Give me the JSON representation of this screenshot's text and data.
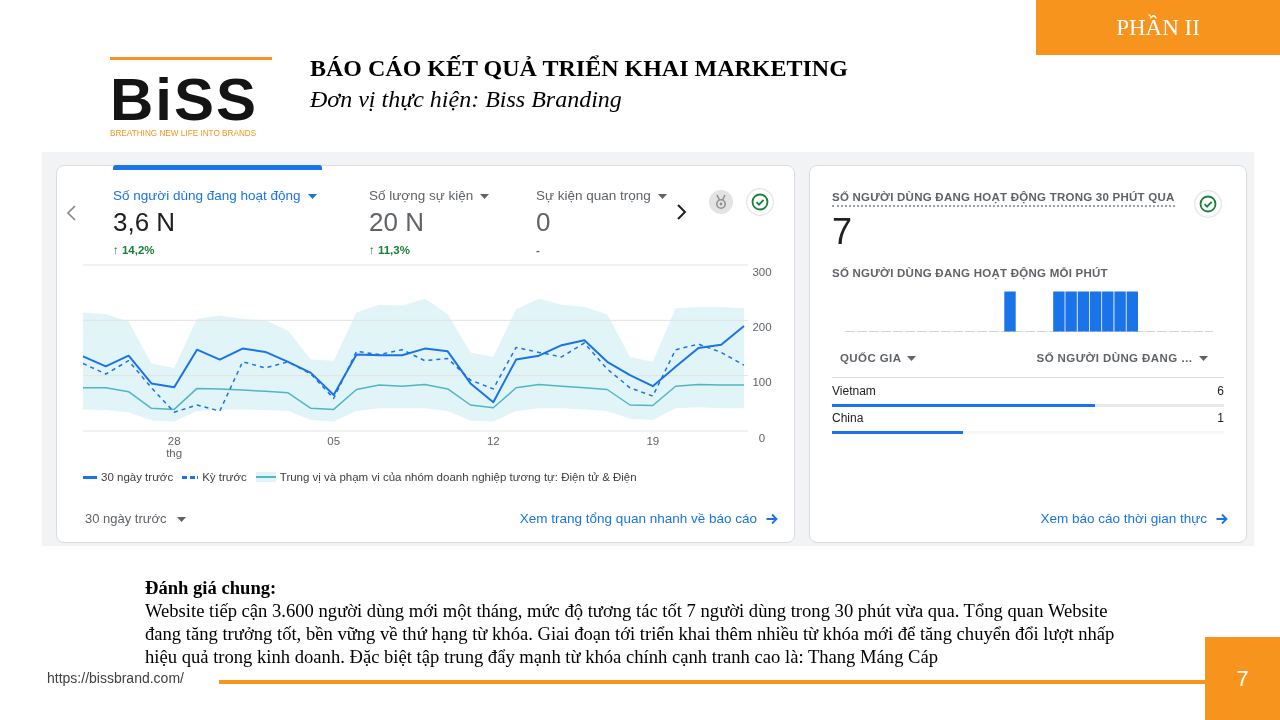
{
  "section_label": "PHẦN II",
  "logo": {
    "wordmark": "BiSS",
    "tagline": "BREATHING NEW LIFE INTO BRANDS"
  },
  "header": {
    "title": "BÁO CÁO KẾT QUẢ TRIỂN KHAI MARKETING",
    "subtitle": "Đơn vị thực hiện: Biss Branding"
  },
  "overview_card": {
    "metrics": [
      {
        "label": "Số người dùng đang hoạt động",
        "value": "3,6 N",
        "change": "↑ 14,2%",
        "positive": true,
        "selected": true
      },
      {
        "label": "Số lượng sự kiện",
        "value": "20 N",
        "change": "↑ 11,3%",
        "positive": true,
        "selected": false
      },
      {
        "label": "Sự kiện quan trọng",
        "value": "0",
        "change": "-",
        "positive": false,
        "selected": false
      }
    ],
    "chart_data": {
      "type": "line",
      "categories": [
        null,
        null,
        null,
        null,
        "28 thg",
        null,
        null,
        null,
        null,
        null,
        null,
        "05",
        null,
        null,
        null,
        null,
        null,
        null,
        "12",
        null,
        null,
        null,
        null,
        null,
        null,
        "19",
        null,
        null,
        null,
        null
      ],
      "ylim": [
        0,
        300
      ],
      "yticks": [
        0,
        100,
        200,
        300
      ],
      "series": [
        {
          "name": "30 ngày trước",
          "color": "#1a73e8",
          "line_style": "solid",
          "values": [
            135,
            117,
            136,
            86,
            79,
            147,
            129,
            149,
            143,
            125,
            105,
            65,
            138,
            137,
            137,
            149,
            144,
            86,
            52,
            129,
            136,
            155,
            164,
            125,
            101,
            81,
            116,
            150,
            156,
            190
          ]
        },
        {
          "name": "Kỳ trước",
          "color": "#1a73e8",
          "line_style": "dashed",
          "values": [
            122,
            103,
            127,
            78,
            34,
            47,
            36,
            125,
            114,
            125,
            103,
            59,
            144,
            138,
            147,
            127,
            131,
            92,
            76,
            151,
            142,
            134,
            159,
            112,
            78,
            63,
            147,
            157,
            142,
            119
          ]
        },
        {
          "name": "Trung vị và phạm vi của nhóm doanh nghiệp tương tự: Điện tử & Điện",
          "color": "#4fb6c3",
          "line_style": "solid",
          "values": [
            78,
            78,
            71,
            41,
            39,
            77,
            76,
            74,
            72,
            69,
            41,
            39,
            75,
            83,
            81,
            84,
            76,
            47,
            42,
            78,
            84,
            81,
            78,
            75,
            47,
            46,
            81,
            84,
            83,
            83
          ]
        }
      ]
    },
    "period_select": {
      "value": "30 ngày trước"
    },
    "link": "Xem trang tổng quan nhanh về báo cáo"
  },
  "realtime_card": {
    "title": "SỐ NGƯỜI DÙNG ĐANG HOẠT ĐỘNG TRONG 30 PHÚT QUA",
    "value": "7",
    "per_minute_label": "SỐ NGƯỜI DÙNG ĐANG HOẠT ĐỘNG MỖI PHÚT",
    "table": {
      "columns": [
        "QUỐC GIA",
        "SỐ NGƯỜI DÙNG ĐANG …"
      ],
      "rows": [
        {
          "country": "Vietnam",
          "users": "6",
          "level": 0.67
        },
        {
          "country": "China",
          "users": "1",
          "level": 0.335
        }
      ]
    },
    "link": "Xem báo cáo thời gian thực"
  },
  "summary": {
    "heading": "Đánh giá chung:",
    "text": "Website tiếp cận 3.600 người dùng mới một tháng, mức độ tương tác tốt 7 người dùng trong 30 phút vừa qua. Tổng quan Website đang tăng trưởng tốt, bền vững về thứ hạng từ khóa. Giai đoạn tới triển khai thêm nhiều từ khóa mới để tăng chuyển đổi lượt nhấp hiệu quả trong kinh doanh. Đặc biệt tập trung đẩy mạnh từ khóa chính cạnh tranh cao là: Thang Máng Cáp"
  },
  "footer": {
    "url": "https://bissbrand.com/",
    "page_number": "7"
  }
}
